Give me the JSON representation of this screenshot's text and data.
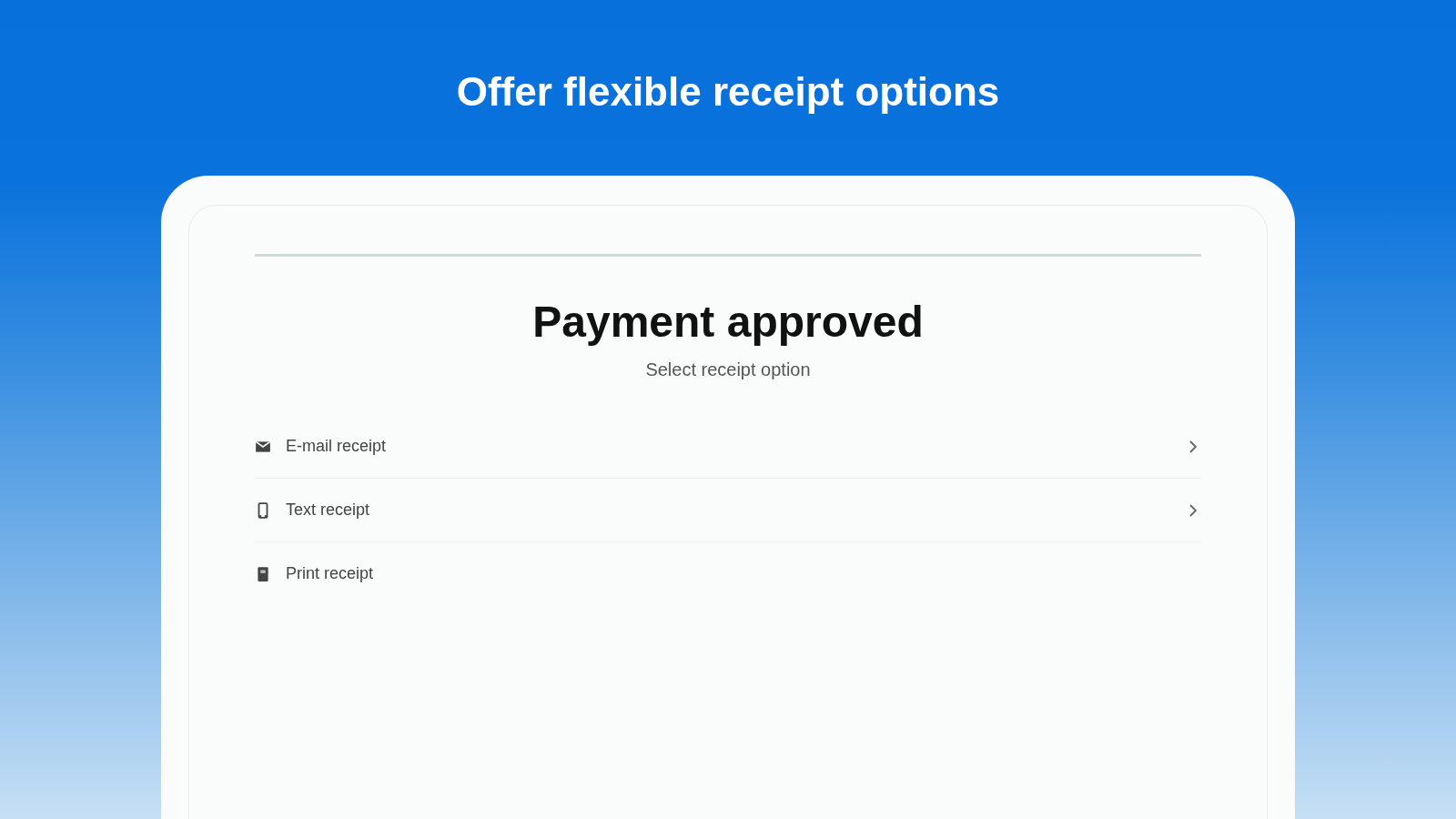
{
  "headline": "Offer flexible receipt options",
  "screen": {
    "title": "Payment approved",
    "subtitle": "Select receipt option",
    "options": [
      {
        "kind": "email",
        "label": "E-mail receipt",
        "chevron": true
      },
      {
        "kind": "phone",
        "label": "Text receipt",
        "chevron": true
      },
      {
        "kind": "print",
        "label": "Print receipt",
        "chevron": false
      }
    ]
  }
}
